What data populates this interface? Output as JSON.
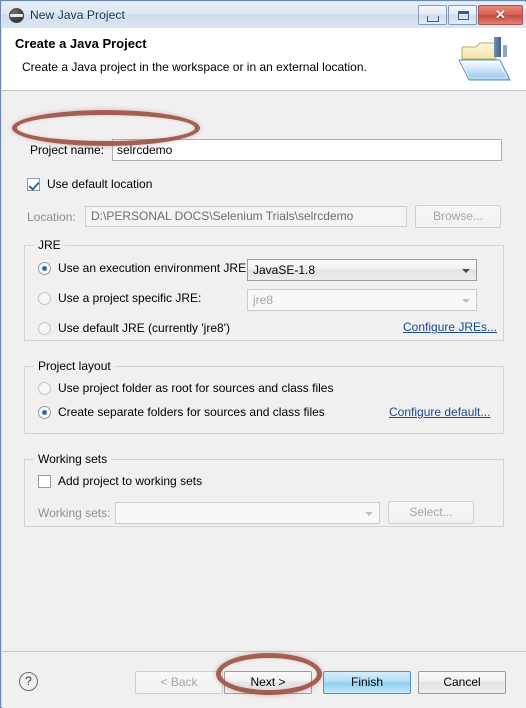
{
  "window": {
    "title": "New Java Project",
    "icon": "eclipse-icon",
    "buttons": {
      "minimize": "minimize-icon",
      "maximize": "maximize-icon",
      "close": "✕"
    }
  },
  "banner": {
    "title": "Create a Java Project",
    "subtitle": "Create a Java project in the workspace or in an external location.",
    "icon": "java-project-wizard-icon"
  },
  "project": {
    "name_label": "Project name:",
    "name_value": "selrcdemo",
    "name_placeholder": "",
    "use_default_location_label": "Use default location",
    "use_default_location_checked": true,
    "location_label": "Location:",
    "location_value": "D:\\PERSONAL DOCS\\Selenium Trials\\selrcdemo",
    "browse_label": "Browse..."
  },
  "jre": {
    "group_title": "JRE",
    "options": [
      {
        "label": "Use an execution environment JRE:",
        "selected": true,
        "combo_value": "JavaSE-1.8",
        "combo_enabled": true
      },
      {
        "label": "Use a project specific JRE:",
        "selected": false,
        "combo_value": "jre8",
        "combo_enabled": false
      },
      {
        "label": "Use default JRE (currently 'jre8')",
        "selected": false
      }
    ],
    "configure_link": "Configure JREs..."
  },
  "layout": {
    "group_title": "Project layout",
    "options": [
      {
        "label": "Use project folder as root for sources and class files",
        "selected": false
      },
      {
        "label": "Create separate folders for sources and class files",
        "selected": true
      }
    ],
    "configure_link": "Configure default..."
  },
  "working_sets": {
    "group_title": "Working sets",
    "add_label": "Add project to working sets",
    "add_checked": false,
    "sets_label": "Working sets:",
    "sets_value": "",
    "select_label": "Select..."
  },
  "footer": {
    "help": "?",
    "back": "< Back",
    "next": "Next >",
    "finish": "Finish",
    "cancel": "Cancel",
    "back_enabled": false,
    "finish_is_default": true
  },
  "annotations": {
    "color": "#9e5245",
    "targets": [
      "project-name-field",
      "next-button"
    ]
  }
}
